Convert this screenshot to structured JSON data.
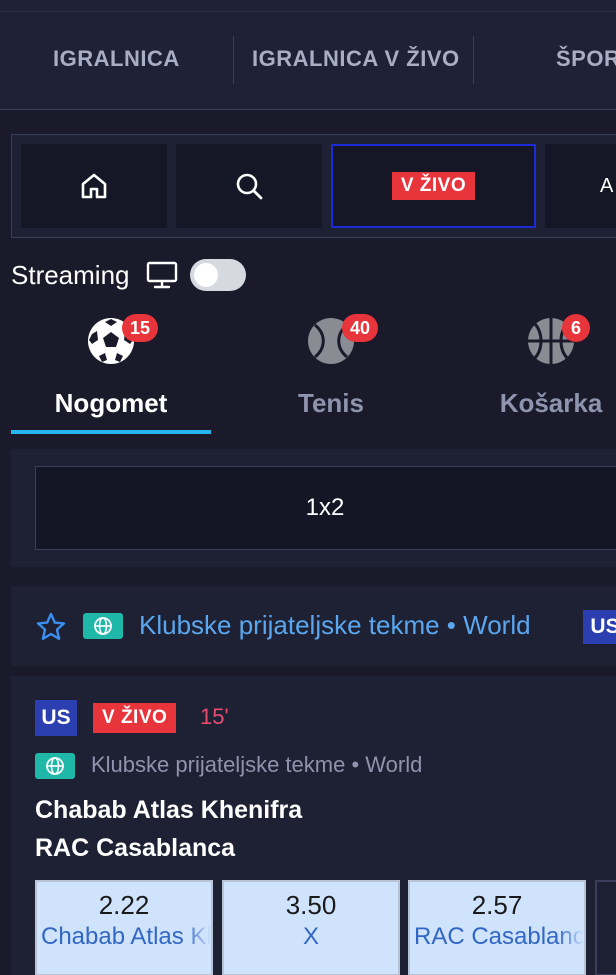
{
  "topnav": {
    "tabs": [
      "IGRALNICA",
      "IGRALNICA V ŽIVO",
      "ŠPORT"
    ]
  },
  "toolbar": {
    "home_icon": "home-icon",
    "search_icon": "search-icon",
    "live_label": "V ŽIVO",
    "next_label": "A"
  },
  "streaming": {
    "label": "Streaming",
    "icon": "monitor-icon",
    "enabled": false
  },
  "sports": [
    {
      "name": "Nogomet",
      "count": "15",
      "icon": "soccer-ball-icon",
      "active": true
    },
    {
      "name": "Tenis",
      "count": "40",
      "icon": "tennis-ball-icon",
      "active": false
    },
    {
      "name": "Košarka",
      "count": "6",
      "icon": "basketball-icon",
      "active": false
    }
  ],
  "market": {
    "label": "1x2"
  },
  "league": {
    "name": "Klubske prijateljske tekme • World",
    "region_badge": "US"
  },
  "event": {
    "region_badge": "US",
    "status": "V ŽIVO",
    "minute": "15'",
    "league": "Klubske prijateljske tekme • World",
    "home": "Chabab Atlas Khenifra",
    "away": "RAC Casablanca",
    "odds": [
      {
        "value": "2.22",
        "label": "Chabab Atlas Khenifra"
      },
      {
        "value": "3.50",
        "label": "X"
      },
      {
        "value": "2.57",
        "label": "RAC Casablanca"
      }
    ]
  },
  "colors": {
    "background": "#1a1a2b",
    "live_red": "#e8343b",
    "accent_blue": "#29b4ef",
    "league_blue": "#5aa7ef",
    "odds_bg": "#cfe3fc"
  }
}
